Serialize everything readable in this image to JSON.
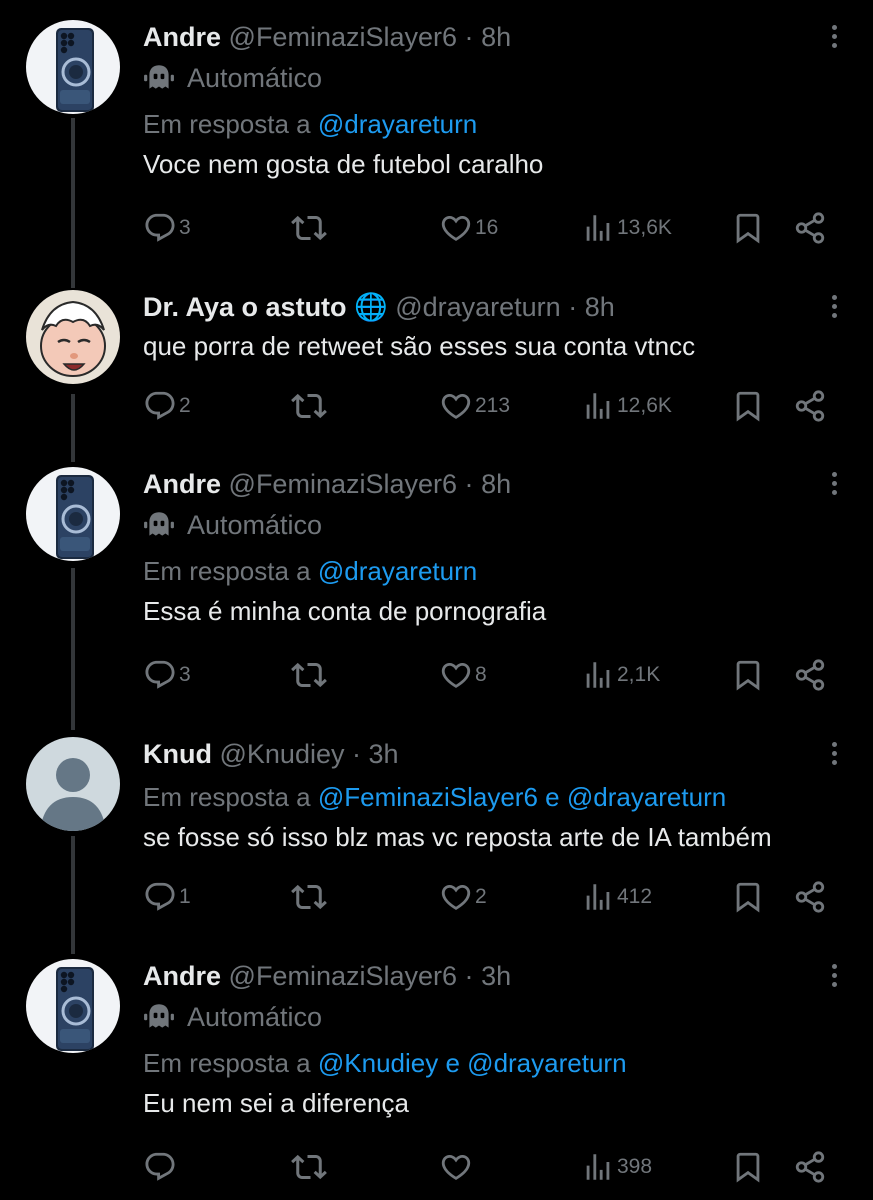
{
  "tweets": [
    {
      "name": "Andre",
      "handle": "@FeminaziSlayer6",
      "time": "8h",
      "automated_label": "Automático",
      "reply_prefix": "Em resposta a",
      "reply_to": "@drayareturn",
      "reply_to_2": "",
      "reply_joiner": "",
      "text": "Voce nem gosta de futebol caralho",
      "replies": "3",
      "retweets": "",
      "likes": "16",
      "views": "13,6K",
      "avatar": "phone-avatar"
    },
    {
      "name": "Dr. Aya o astuto",
      "badge": "🌐",
      "handle": "@drayareturn",
      "time": "8h",
      "text": "que porra de retweet são esses sua conta vtncc",
      "replies": "2",
      "retweets": "",
      "likes": "213",
      "views": "12,6K",
      "avatar": "cartoon-avatar"
    },
    {
      "name": "Andre",
      "handle": "@FeminaziSlayer6",
      "time": "8h",
      "automated_label": "Automático",
      "reply_prefix": "Em resposta a",
      "reply_to": "@drayareturn",
      "text": "Essa é minha conta de pornografia",
      "replies": "3",
      "retweets": "",
      "likes": "8",
      "views": "2,1K",
      "avatar": "phone-avatar"
    },
    {
      "name": "Knud",
      "handle": "@Knudiey",
      "time": "3h",
      "reply_prefix": "Em resposta a",
      "reply_to": "@FeminaziSlayer6",
      "reply_joiner": "e",
      "reply_to_2": "@drayareturn",
      "text": "se fosse só isso blz mas vc reposta arte de IA também",
      "replies": "1",
      "retweets": "",
      "likes": "2",
      "views": "412",
      "avatar": "default-avatar"
    },
    {
      "name": "Andre",
      "handle": "@FeminaziSlayer6",
      "time": "3h",
      "automated_label": "Automático",
      "reply_prefix": "Em resposta a",
      "reply_to": "@Knudiey",
      "reply_joiner": "e",
      "reply_to_2": "@drayareturn",
      "text": "Eu nem sei a diferença",
      "replies": "",
      "retweets": "",
      "likes": "",
      "views": "398",
      "avatar": "phone-avatar"
    }
  ],
  "separator": "·",
  "colors": {
    "background": "#000000",
    "text": "#e7e9ea",
    "muted": "#71767b",
    "link": "#1d9bf0",
    "thread_line": "#333639"
  },
  "icons": [
    "more-icon",
    "bot-icon",
    "reply-icon",
    "retweet-icon",
    "like-icon",
    "views-icon",
    "bookmark-icon",
    "share-icon"
  ]
}
